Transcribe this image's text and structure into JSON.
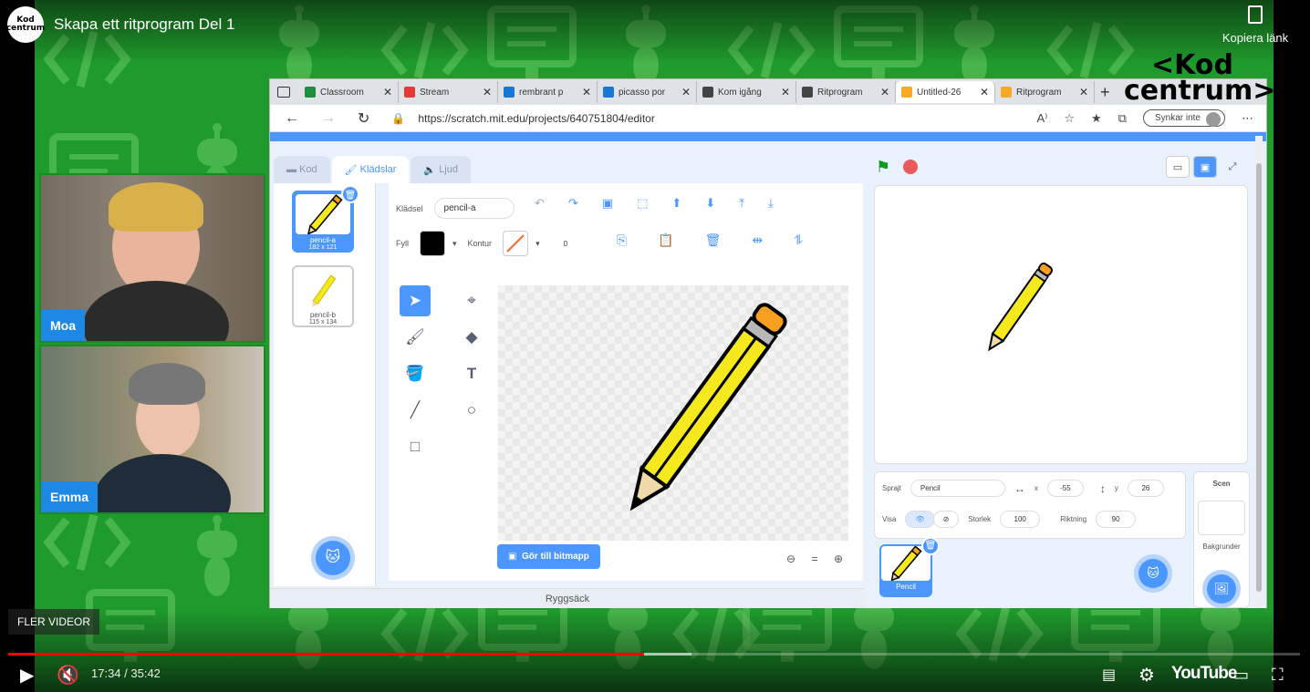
{
  "header": {
    "channel_avatar_text": "Kod centrum",
    "title": "Skapa ett ritprogram Del 1",
    "copy_link": "Kopiera länk"
  },
  "overlay_logo": {
    "text_line1": "<Kod",
    "text_line2": "centrum>"
  },
  "webcams": [
    {
      "name": "Moa"
    },
    {
      "name": "Emma"
    }
  ],
  "browser": {
    "tabs": [
      {
        "label": "Classroom",
        "fav_color": "#1e8e3e",
        "active": false
      },
      {
        "label": "Stream",
        "fav_color": "#e53935",
        "active": false
      },
      {
        "label": "rembrant p",
        "fav_color": "#1976d2",
        "active": false
      },
      {
        "label": "picasso por",
        "fav_color": "#1976d2",
        "active": false
      },
      {
        "label": "Kom igång",
        "fav_color": "#444444",
        "active": false
      },
      {
        "label": "Ritprogram",
        "fav_color": "#444444",
        "active": false
      },
      {
        "label": "Untitled-26",
        "fav_color": "#f9a825",
        "active": true
      },
      {
        "label": "Ritprogram",
        "fav_color": "#f9a825",
        "active": false
      }
    ],
    "close_glyph": "✕",
    "new_tab": "+",
    "url": "https://scratch.mit.edu/projects/640751804/editor",
    "sync_label": "Synkar inte"
  },
  "scratch": {
    "tabs": {
      "code": "Kod",
      "costumes": "Klädslar",
      "sounds": "Ljud"
    },
    "costumes": [
      {
        "num": "1",
        "name": "pencil-a",
        "size": "182 x 121",
        "selected": true
      },
      {
        "num": "2",
        "name": "pencil-b",
        "size": "115 x 134",
        "selected": false
      }
    ],
    "paint": {
      "costume_label": "Klädsel",
      "costume_name": "pencil-a",
      "fill_label": "Fyll",
      "outline_label": "Kontur",
      "outline_width": "0",
      "bitmap_button": "Gör till bitmapp",
      "zoom_reset": "="
    },
    "backpack": "Ryggsäck",
    "sprite_info": {
      "sprite_label": "Sprajt",
      "sprite_name": "Pencil",
      "x_label": "x",
      "x_value": "-55",
      "y_label": "y",
      "y_value": "26",
      "show_label": "Visa",
      "size_label": "Storlek",
      "size_value": "100",
      "direction_label": "Riktning",
      "direction_value": "90"
    },
    "sprite_tile_name": "Pencil",
    "stage_panel": {
      "title": "Scen",
      "backdrops": "Bakgrunder"
    }
  },
  "player": {
    "more_videos": "FLER VIDEOR",
    "time": "17:34 / 35:42",
    "progress_fraction": 0.492,
    "youtube_logo": "YouTube"
  },
  "colors": {
    "background_green": "#1f9a2c",
    "scratch_blue": "#4c97ff",
    "progress_red": "#ff0000",
    "pencil_yellow": "#f5e81c",
    "eraser_orange": "#f7a020"
  }
}
